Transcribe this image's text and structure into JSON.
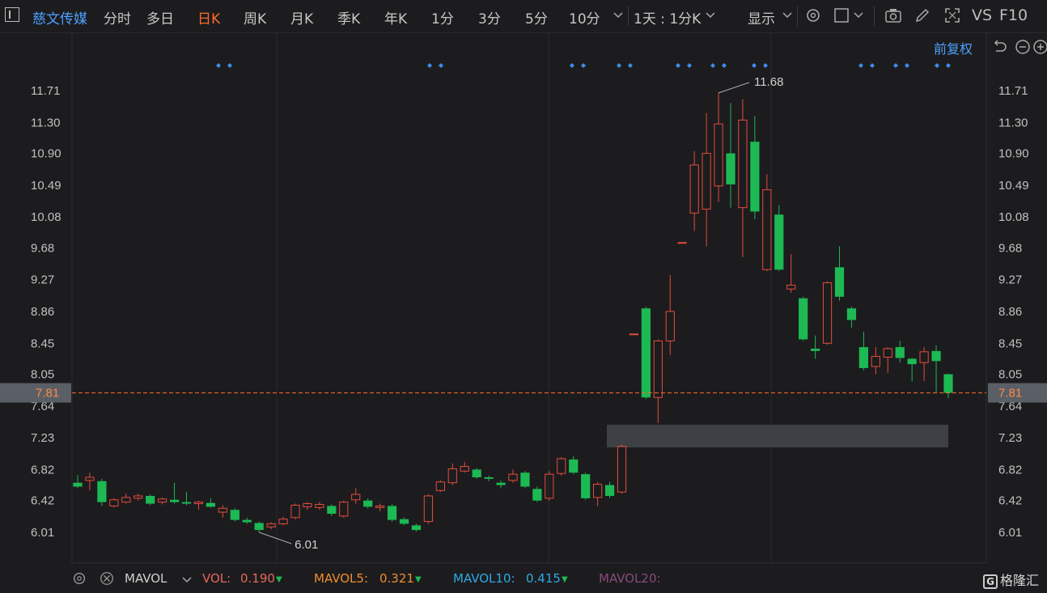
{
  "toolbar": {
    "stock_name": "慈文传媒",
    "tabs": [
      "分时",
      "多日",
      "日K",
      "周K",
      "月K",
      "季K",
      "年K",
      "1分",
      "3分",
      "5分",
      "10分"
    ],
    "active_tab": "日K",
    "interval": "1天 : 1分K",
    "display": "显示",
    "vs": "VS",
    "f10": "F10"
  },
  "adjust_label": "前复权",
  "chart_data": {
    "type": "candlestick",
    "y_ticks": [
      "11.71",
      "11.30",
      "10.90",
      "10.49",
      "10.08",
      "9.68",
      "9.27",
      "8.86",
      "8.45",
      "8.05",
      "7.64",
      "7.23",
      "6.82",
      "6.42",
      "6.01"
    ],
    "ylim": [
      5.71,
      12.02
    ],
    "current_price": "7.81",
    "high_label": "11.68",
    "low_label": "6.01",
    "candles": [
      [
        6.65,
        6.6,
        6.75,
        6.58
      ],
      [
        6.68,
        6.72,
        6.78,
        6.55
      ],
      [
        6.67,
        6.4,
        6.7,
        6.35
      ],
      [
        6.35,
        6.43,
        6.45,
        6.33
      ],
      [
        6.4,
        6.46,
        6.51,
        6.38
      ],
      [
        6.45,
        6.48,
        6.51,
        6.42
      ],
      [
        6.48,
        6.38,
        6.5,
        6.36
      ],
      [
        6.4,
        6.44,
        6.46,
        6.37
      ],
      [
        6.43,
        6.4,
        6.65,
        6.38
      ],
      [
        6.4,
        6.38,
        6.53,
        6.36
      ],
      [
        6.38,
        6.4,
        6.42,
        6.3
      ],
      [
        6.39,
        6.34,
        6.45,
        6.33
      ],
      [
        6.27,
        6.32,
        6.36,
        6.2
      ],
      [
        6.3,
        6.17,
        6.32,
        6.15
      ],
      [
        6.17,
        6.14,
        6.2,
        6.12
      ],
      [
        6.13,
        6.04,
        6.15,
        6.01
      ],
      [
        6.08,
        6.12,
        6.14,
        6.05
      ],
      [
        6.12,
        6.18,
        6.21,
        6.1
      ],
      [
        6.2,
        6.36,
        6.38,
        6.18
      ],
      [
        6.34,
        6.38,
        6.4,
        6.3
      ],
      [
        6.33,
        6.37,
        6.4,
        6.3
      ],
      [
        6.35,
        6.25,
        6.37,
        6.22
      ],
      [
        6.22,
        6.4,
        6.42,
        6.2
      ],
      [
        6.43,
        6.5,
        6.58,
        6.38
      ],
      [
        6.42,
        6.34,
        6.45,
        6.32
      ],
      [
        6.33,
        6.35,
        6.38,
        6.28
      ],
      [
        6.35,
        6.17,
        6.37,
        6.15
      ],
      [
        6.18,
        6.12,
        6.2,
        6.1
      ],
      [
        6.1,
        6.04,
        6.12,
        6.02
      ],
      [
        6.15,
        6.48,
        6.5,
        6.12
      ],
      [
        6.55,
        6.66,
        6.68,
        6.53
      ],
      [
        6.65,
        6.83,
        6.9,
        6.62
      ],
      [
        6.8,
        6.86,
        6.92,
        6.78
      ],
      [
        6.82,
        6.72,
        6.84,
        6.7
      ],
      [
        6.72,
        6.7,
        6.74,
        6.67
      ],
      [
        6.65,
        6.62,
        6.68,
        6.58
      ],
      [
        6.68,
        6.76,
        6.82,
        6.65
      ],
      [
        6.78,
        6.6,
        6.8,
        6.58
      ],
      [
        6.57,
        6.42,
        6.6,
        6.4
      ],
      [
        6.45,
        6.76,
        6.8,
        6.42
      ],
      [
        6.77,
        6.96,
        6.98,
        6.74
      ],
      [
        6.95,
        6.78,
        6.99,
        6.76
      ],
      [
        6.76,
        6.45,
        6.78,
        6.43
      ],
      [
        6.46,
        6.63,
        6.66,
        6.35
      ],
      [
        6.62,
        6.48,
        6.66,
        6.45
      ],
      [
        6.53,
        7.12,
        7.14,
        6.51
      ],
      [
        8.57,
        8.57,
        8.57,
        8.57
      ],
      [
        8.9,
        7.75,
        8.92,
        7.73
      ],
      [
        7.75,
        8.48,
        8.5,
        7.42
      ],
      [
        8.48,
        8.86,
        9.33,
        8.3
      ],
      [
        9.75,
        9.75,
        9.75,
        9.75
      ],
      [
        10.13,
        10.75,
        10.93,
        9.9
      ],
      [
        10.18,
        10.9,
        11.42,
        9.7
      ],
      [
        10.48,
        11.28,
        11.68,
        10.27
      ],
      [
        10.9,
        10.5,
        11.55,
        10.2
      ],
      [
        10.2,
        11.33,
        11.6,
        9.56
      ],
      [
        11.05,
        10.15,
        11.38,
        10.05
      ],
      [
        9.4,
        10.43,
        10.63,
        9.38
      ],
      [
        10.11,
        9.4,
        10.23,
        9.38
      ],
      [
        9.15,
        9.2,
        9.6,
        9.1
      ],
      [
        9.03,
        8.5,
        9.05,
        8.48
      ],
      [
        8.38,
        8.35,
        8.55,
        8.25
      ],
      [
        8.45,
        9.23,
        9.25,
        8.43
      ],
      [
        9.43,
        9.05,
        9.7,
        9.0
      ],
      [
        8.9,
        8.75,
        8.92,
        8.65
      ],
      [
        8.4,
        8.13,
        8.6,
        8.1
      ],
      [
        8.15,
        8.28,
        8.4,
        8.05
      ],
      [
        8.27,
        8.38,
        8.4,
        8.07
      ],
      [
        8.4,
        8.26,
        8.48,
        8.2
      ],
      [
        8.25,
        8.18,
        8.26,
        7.96
      ],
      [
        8.2,
        8.34,
        8.4,
        7.96
      ],
      [
        8.35,
        8.22,
        8.42,
        7.81
      ],
      [
        8.05,
        7.81,
        8.06,
        7.74
      ]
    ],
    "event_markers_x": [
      277,
      538,
      714,
      772,
      845,
      888,
      939,
      1071,
      1114,
      1165
    ],
    "vol_indicator": {
      "name": "MAVOL",
      "vol": "0.190",
      "mavol5": "0.321",
      "mavol10": "0.415",
      "mavol20_label": "MAVOL20:"
    }
  },
  "colors": {
    "up": "#e54b3c",
    "down": "#1db954",
    "accent": "#ff6a2b",
    "blue": "#4ea0ff",
    "mavol5": "#f08c2e",
    "mavol10": "#2ea8e6",
    "mavol20": "#8a4a7a"
  },
  "logo": "格隆汇"
}
